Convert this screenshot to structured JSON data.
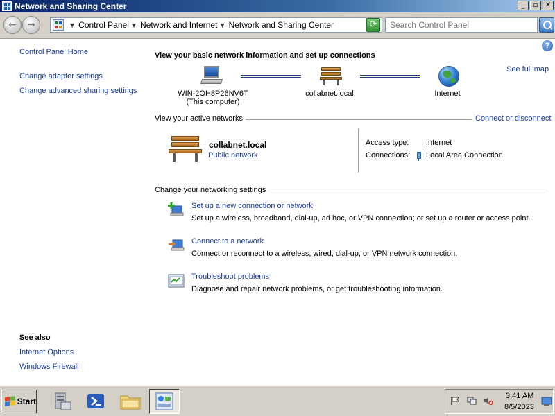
{
  "window": {
    "title": "Network and Sharing Center",
    "controls": [
      "minimize",
      "maximize",
      "close"
    ]
  },
  "address_bar": {
    "breadcrumb": [
      "Control Panel",
      "Network and Internet",
      "Network and Sharing Center"
    ],
    "search_placeholder": "Search Control Panel"
  },
  "left_pane": {
    "home": "Control Panel Home",
    "links": [
      "Change adapter settings",
      "Change advanced sharing settings"
    ],
    "see_also_title": "See also",
    "see_also": [
      "Internet Options",
      "Windows Firewall"
    ]
  },
  "main": {
    "heading": "View your basic network information and set up connections",
    "see_full_map": "See full map",
    "map": {
      "computer_name": "WIN-2OH8P26NV6T",
      "computer_sub": "(This computer)",
      "network": "collabnet.local",
      "internet": "Internet"
    },
    "active_networks_label": "View your active networks",
    "connect_disconnect": "Connect or disconnect",
    "active_network": {
      "name": "collabnet.local",
      "type": "Public network",
      "access_type_label": "Access type:",
      "access_type_value": "Internet",
      "connections_label": "Connections:",
      "connections_value": "Local Area Connection"
    },
    "networking_settings_label": "Change your networking settings",
    "tasks": [
      {
        "title": "Set up a new connection or network",
        "desc": "Set up a wireless, broadband, dial-up, ad hoc, or VPN connection; or set up a router or access point."
      },
      {
        "title": "Connect to a network",
        "desc": "Connect or reconnect to a wireless, wired, dial-up, or VPN network connection."
      },
      {
        "title": "Troubleshoot problems",
        "desc": "Diagnose and repair network problems, or get troubleshooting information."
      }
    ]
  },
  "taskbar": {
    "start_label": "Start",
    "apps": [
      "server-manager",
      "powershell",
      "explorer",
      "network-and-sharing-center"
    ],
    "clock_time": "3:41 AM",
    "clock_date": "8/5/2023"
  }
}
